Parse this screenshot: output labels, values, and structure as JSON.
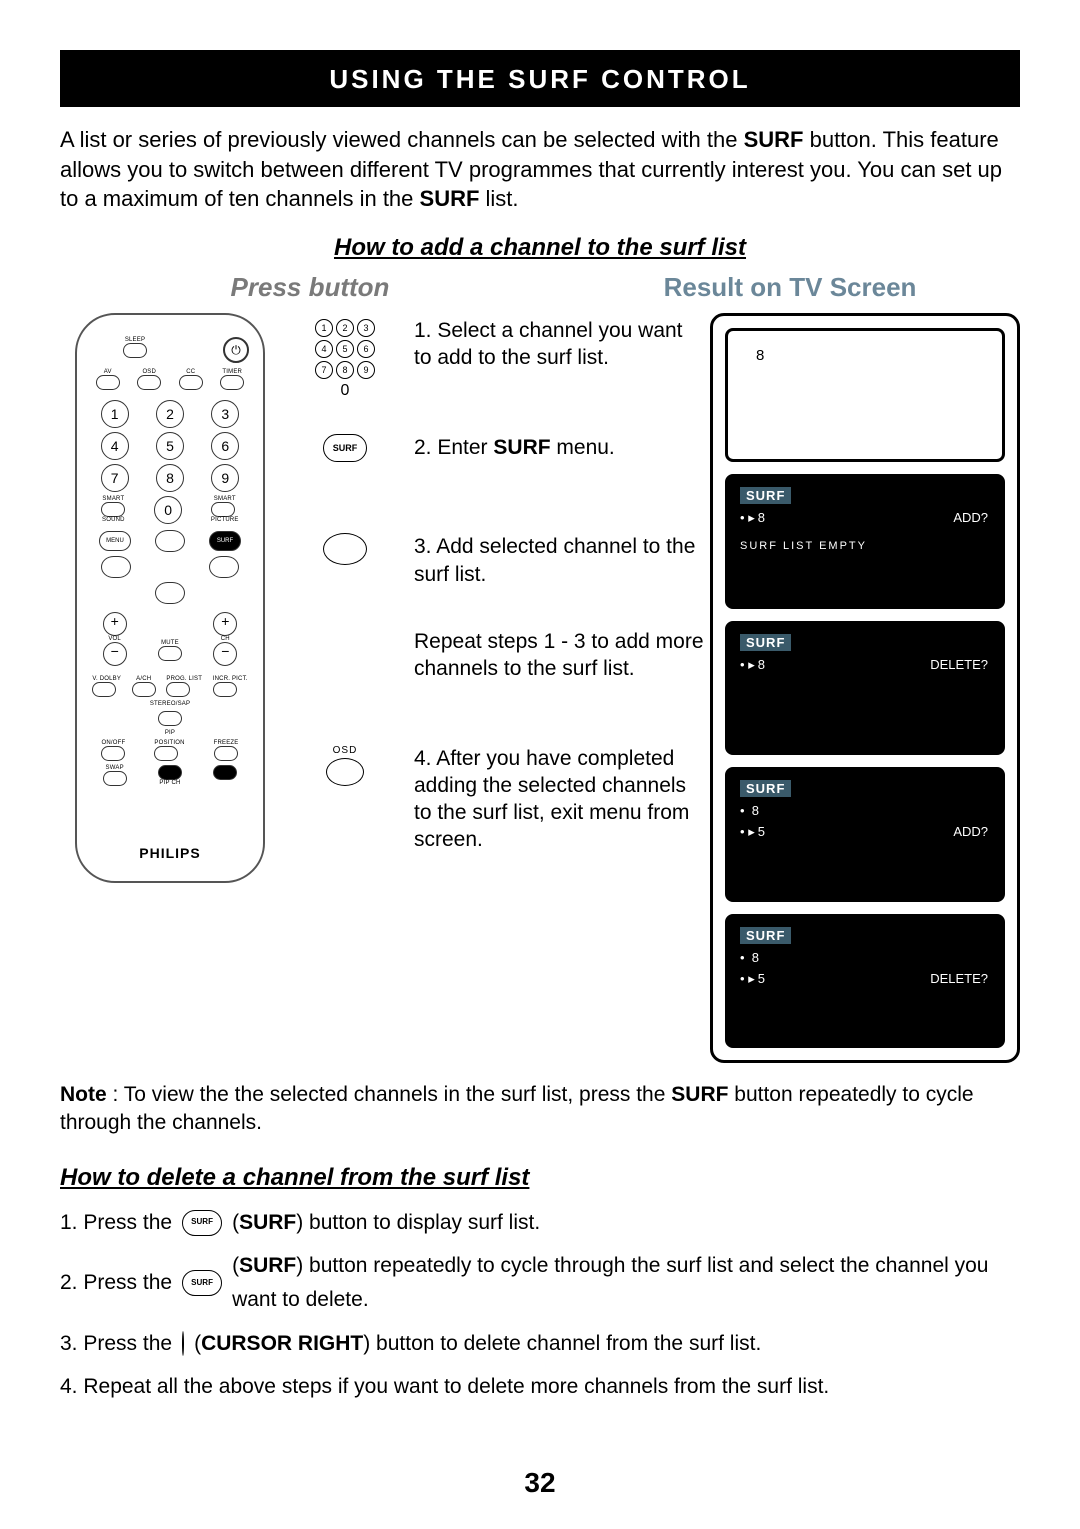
{
  "title": "USING THE SURF CONTROL",
  "intro_1": "A list or series of previously viewed channels can be selected with the ",
  "intro_surf": "SURF",
  "intro_2": " button. This feature allows you to switch between different TV programmes that currently interest you. You can set up to a maximum of ten channels in the ",
  "intro_surf2": "SURF",
  "intro_3": " list.",
  "add_heading": "How to add a channel to the surf list",
  "press_button": "Press button",
  "result_label": "Result on TV Screen",
  "remote_brand": "PHILIPS",
  "steps": {
    "s1": "1. Select a channel you want to add to the surf list.",
    "s2a": "2. Enter ",
    "s2b": "SURF",
    "s2c": " menu.",
    "s3": "3. Add selected channel to the surf list.",
    "repeat": "Repeat steps 1 - 3 to add more channels to the surf list.",
    "s4": "4. After you have completed adding the selected channels to the surf list, exit menu from screen."
  },
  "osd_label": "OSD",
  "surf_label": "SURF",
  "tv": {
    "blank_num": "8",
    "s2": {
      "hdr": "SURF",
      "line": "8",
      "action": "ADD?",
      "footer": "SURF LIST EMPTY"
    },
    "s3": {
      "hdr": "SURF",
      "line": "8",
      "action": "DELETE?"
    },
    "s4": {
      "hdr": "SURF",
      "l1": "8",
      "l2": "5",
      "action": "ADD?"
    },
    "s5": {
      "hdr": "SURF",
      "l1": "8",
      "l2": "5",
      "action": "DELETE?"
    }
  },
  "note_prefix": "Note",
  "note_body": " : To view the the selected channels in the surf list, press the ",
  "note_bold": "SURF",
  "note_tail": " button repeatedly to cycle through the channels.",
  "del_heading": "How to delete a channel from the surf list",
  "del": {
    "p1a": "1. Press the",
    "p1b": "(",
    "p1c": "SURF",
    "p1d": ") button to display surf list.",
    "p2a": "2. Press the",
    "p2b": "(",
    "p2c": "SURF",
    "p2d": ") button repeatedly to cycle through the surf list and select the channel you want to delete.",
    "p3a": "3. Press the",
    "p3b": "(",
    "p3c": "CURSOR RIGHT",
    "p3d": ") button to delete channel from the surf list.",
    "p4": "4. Repeat all the above steps if you want to delete more channels from the surf list."
  },
  "page": "32",
  "keypad": [
    "1",
    "2",
    "3",
    "4",
    "5",
    "6",
    "7",
    "8",
    "9",
    "0"
  ],
  "remote_labels": {
    "sleep": "SLEEP",
    "av": "AV",
    "osd": "OSD",
    "cc": "CC",
    "timer": "TIMER",
    "smart_l": "SMART",
    "smart_r": "SMART",
    "sound": "SOUND",
    "picture": "PICTURE",
    "menu": "MENU",
    "surf": "SURF",
    "vol": "VOL",
    "ch": "CH",
    "mute": "MUTE",
    "vdolby": "V. DOLBY",
    "aich": "A/CH",
    "proglist": "PROG. LIST",
    "incrpict": "INCR. PICT.",
    "stereo": "STEREO/SAP",
    "pip": "PIP",
    "onoff": "ON/OFF",
    "position": "POSITION",
    "freeze": "FREEZE",
    "swap": "SWAP",
    "chplus": "CH +",
    "chminus": "CH -",
    "pipch": "PIP CH"
  }
}
